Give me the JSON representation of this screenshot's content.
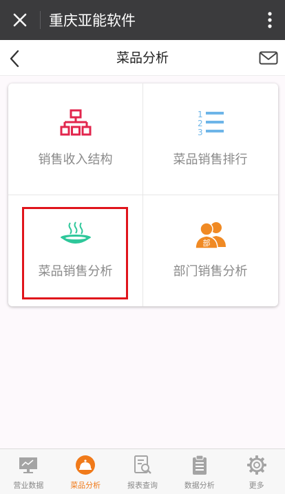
{
  "topbar": {
    "title": "重庆亚能软件"
  },
  "header": {
    "title": "菜品分析"
  },
  "tiles": [
    {
      "label": "销售收入结构",
      "icon": "org-chart-icon"
    },
    {
      "label": "菜品销售排行",
      "icon": "numbered-list-icon"
    },
    {
      "label": "菜品销售分析",
      "icon": "dish-bowl-icon"
    },
    {
      "label": "部门销售分析",
      "icon": "department-people-icon",
      "badge": "部"
    }
  ],
  "tabs": [
    {
      "label": "营业数据",
      "icon": "monitor-chart-icon"
    },
    {
      "label": "菜品分析",
      "icon": "dish-cover-icon"
    },
    {
      "label": "报表查询",
      "icon": "report-search-icon"
    },
    {
      "label": "数据分析",
      "icon": "clipboard-icon"
    },
    {
      "label": "更多",
      "icon": "gear-icon"
    }
  ],
  "colors": {
    "topbar": "#3b3b3d",
    "accent": "#f07a1a",
    "org_icon": "#e2264d",
    "list_icon": "#6db5e8",
    "dish_icon": "#2ec79a",
    "dept_icon": "#f08a24",
    "highlight": "#e0141b"
  }
}
